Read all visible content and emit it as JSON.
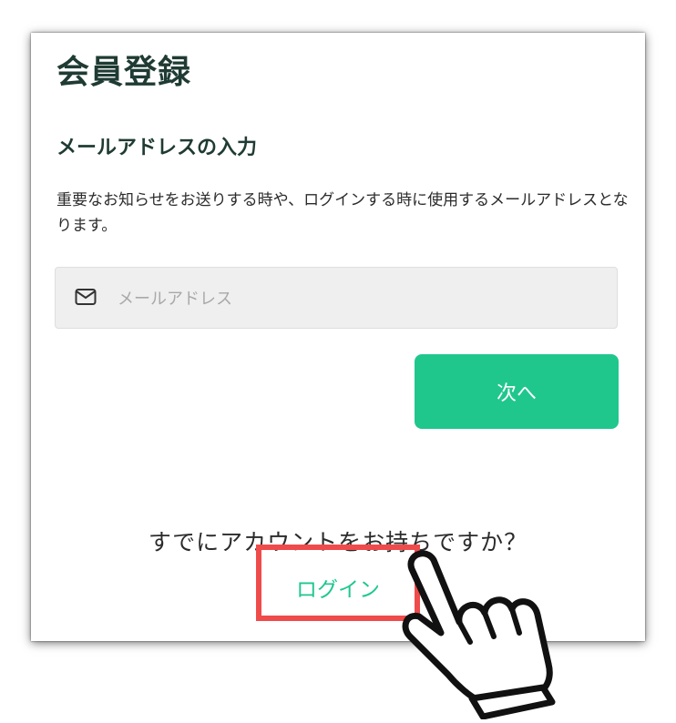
{
  "header": {
    "title": "会員登録"
  },
  "section": {
    "title": "メールアドレスの入力"
  },
  "description": {
    "text": "重要なお知らせをお送りする時や、ログインする時に使用するメールアドレスとなります。"
  },
  "email_field": {
    "placeholder": "メールアドレス",
    "value": "",
    "icon": "mail-icon"
  },
  "next_button": {
    "label": "次へ"
  },
  "footer": {
    "question": "すでにアカウントをお持ちですか？",
    "login_label": "ログイン"
  },
  "overlay": {
    "icon": "pointing-hand-icon",
    "highlight_color": "#ef4b4b"
  },
  "colors": {
    "accent": "#1fc78d",
    "heading": "#1f3b33",
    "input_bg": "#efefef"
  }
}
